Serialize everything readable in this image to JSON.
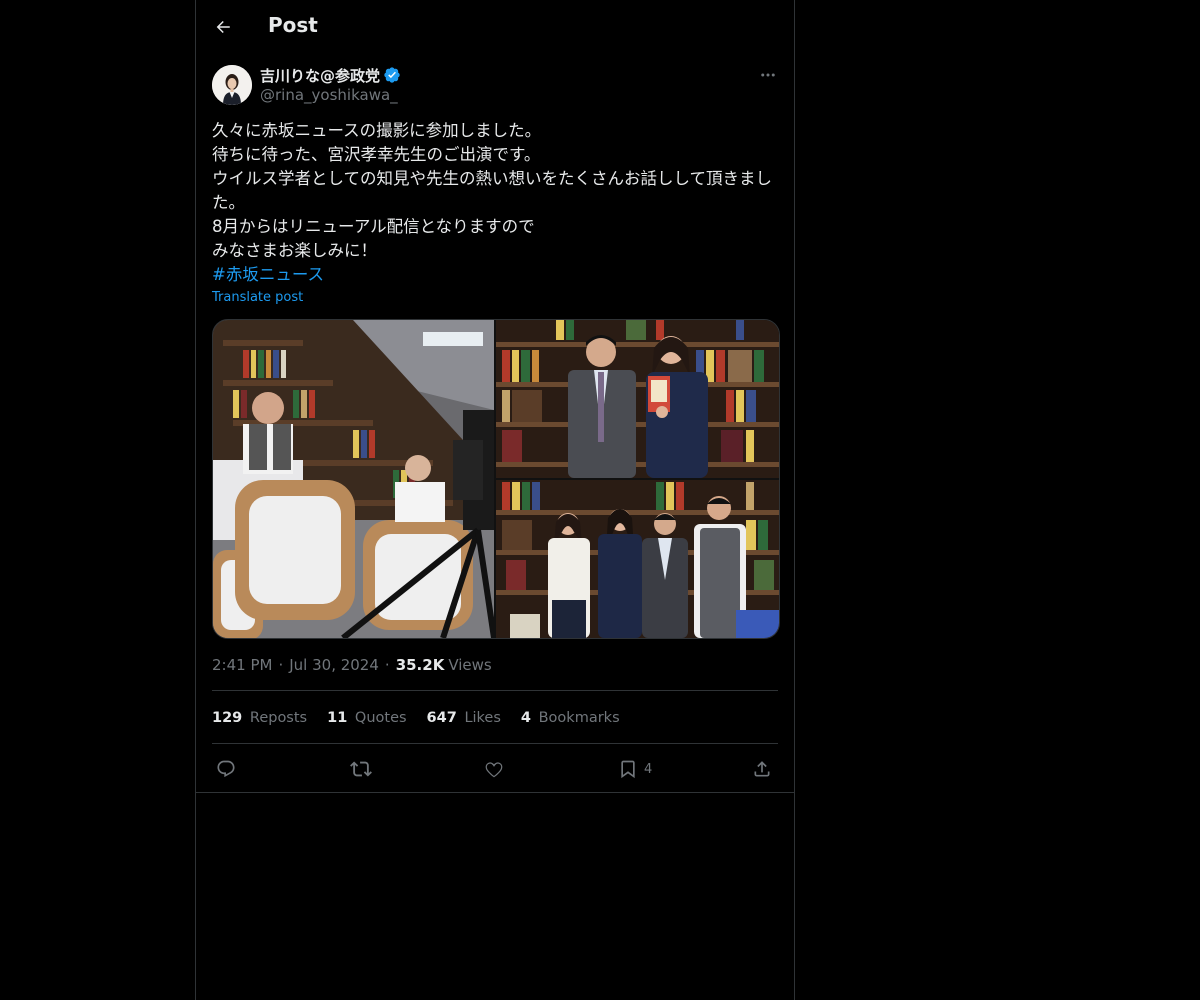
{
  "header": {
    "title": "Post"
  },
  "author": {
    "name": "吉川りな@参政党",
    "handle": "@rina_yoshikawa_"
  },
  "post": {
    "lines": [
      "久々に赤坂ニュースの撮影に参加しました。",
      "待ちに待った、宮沢孝幸先生のご出演です。",
      "ウイルス学者としての知見や先生の熱い想いをたくさんお話しして頂きました。",
      "8月からはリニューアル配信となりますので",
      "みなさまお楽しみに！"
    ],
    "hashtag": "#赤坂ニュース",
    "translate_label": "Translate post"
  },
  "meta": {
    "time": "2:41 PM",
    "date": "Jul 30, 2024",
    "views_count": "35.2K",
    "views_label": "Views"
  },
  "stats": {
    "reposts_count": "129",
    "reposts_label": "Reposts",
    "quotes_count": "11",
    "quotes_label": "Quotes",
    "likes_count": "647",
    "likes_label": "Likes",
    "bookmarks_count": "4",
    "bookmarks_label": "Bookmarks"
  },
  "actions": {
    "bookmark_count": "4"
  },
  "colors": {
    "background": "#000000",
    "text": "#e7e9ea",
    "secondary": "#71767b",
    "accent": "#1d9bf0",
    "border": "#2f3336"
  },
  "icons": [
    "back-arrow-icon",
    "verified-badge-icon",
    "more-icon",
    "reply-icon",
    "repost-icon",
    "like-icon",
    "bookmark-icon",
    "share-icon"
  ]
}
